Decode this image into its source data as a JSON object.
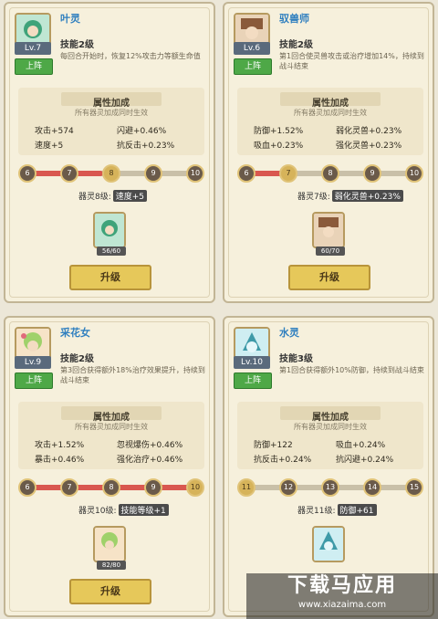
{
  "common": {
    "deploy_label": "上阵",
    "attr_title": "属性加成",
    "attr_sub": "所有器灵加成同时生效",
    "upgrade_label": "升级"
  },
  "cards": [
    {
      "name": "叶灵",
      "level": "Lv.7",
      "skill_name": "技能2级",
      "skill_desc": "每回合开始时，恢复12%攻击力等额生命值",
      "stats": [
        "攻击+574",
        "闪避+0.46%",
        "速度+5",
        "抗反击+0.23%"
      ],
      "track_nodes": [
        "6",
        "7",
        "8",
        "9",
        "10"
      ],
      "current_node": 2,
      "progress": 0.45,
      "bonus_level": "器灵8级:",
      "bonus_tag": "速度+5",
      "gem_count": "56/60",
      "accent_color": "#3fa37a"
    },
    {
      "name": "驭兽师",
      "level": "Lv.6",
      "skill_name": "技能2级",
      "skill_desc": "第1回合使灵兽攻击或治疗增加14%，持续到战斗结束",
      "stats": [
        "防御+1.52%",
        "弱化灵兽+0.23%",
        "吸血+0.23%",
        "强化灵兽+0.23%"
      ],
      "track_nodes": [
        "6",
        "7",
        "8",
        "9",
        "10"
      ],
      "current_node": 1,
      "progress": 0.22,
      "bonus_level": "器灵7级:",
      "bonus_tag": "弱化灵兽+0.23%",
      "gem_count": "60/70",
      "accent_color": "#8a5a3a"
    },
    {
      "name": "采花女",
      "level": "Lv.9",
      "skill_name": "技能2级",
      "skill_desc": "第3回合获得额外18%治疗效果提升，持续到战斗结束",
      "stats": [
        "攻击+1.52%",
        "忽视爆伤+0.46%",
        "暴击+0.46%",
        "强化治疗+0.46%"
      ],
      "track_nodes": [
        "6",
        "7",
        "8",
        "9",
        "10"
      ],
      "current_node": 4,
      "progress": 1.0,
      "bonus_level": "器灵10级:",
      "bonus_tag": "技能等级+1",
      "gem_count": "82/80",
      "accent_color": "#d97aa8"
    },
    {
      "name": "水灵",
      "level": "Lv.10",
      "skill_name": "技能3级",
      "skill_desc": "第1回合获得额外10%防御，持续到战斗结束",
      "stats": [
        "防御+122",
        "吸血+0.24%",
        "抗反击+0.24%",
        "抗闪避+0.24%"
      ],
      "track_nodes": [
        "11",
        "12",
        "13",
        "14",
        "15"
      ],
      "current_node": 0,
      "progress": 0.0,
      "bonus_level": "器灵11级:",
      "bonus_tag": "防御+61",
      "gem_count": "",
      "accent_color": "#3f9aa8"
    }
  ],
  "watermark": {
    "big": "下载马应用",
    "small": "www.xiazaima.com"
  }
}
